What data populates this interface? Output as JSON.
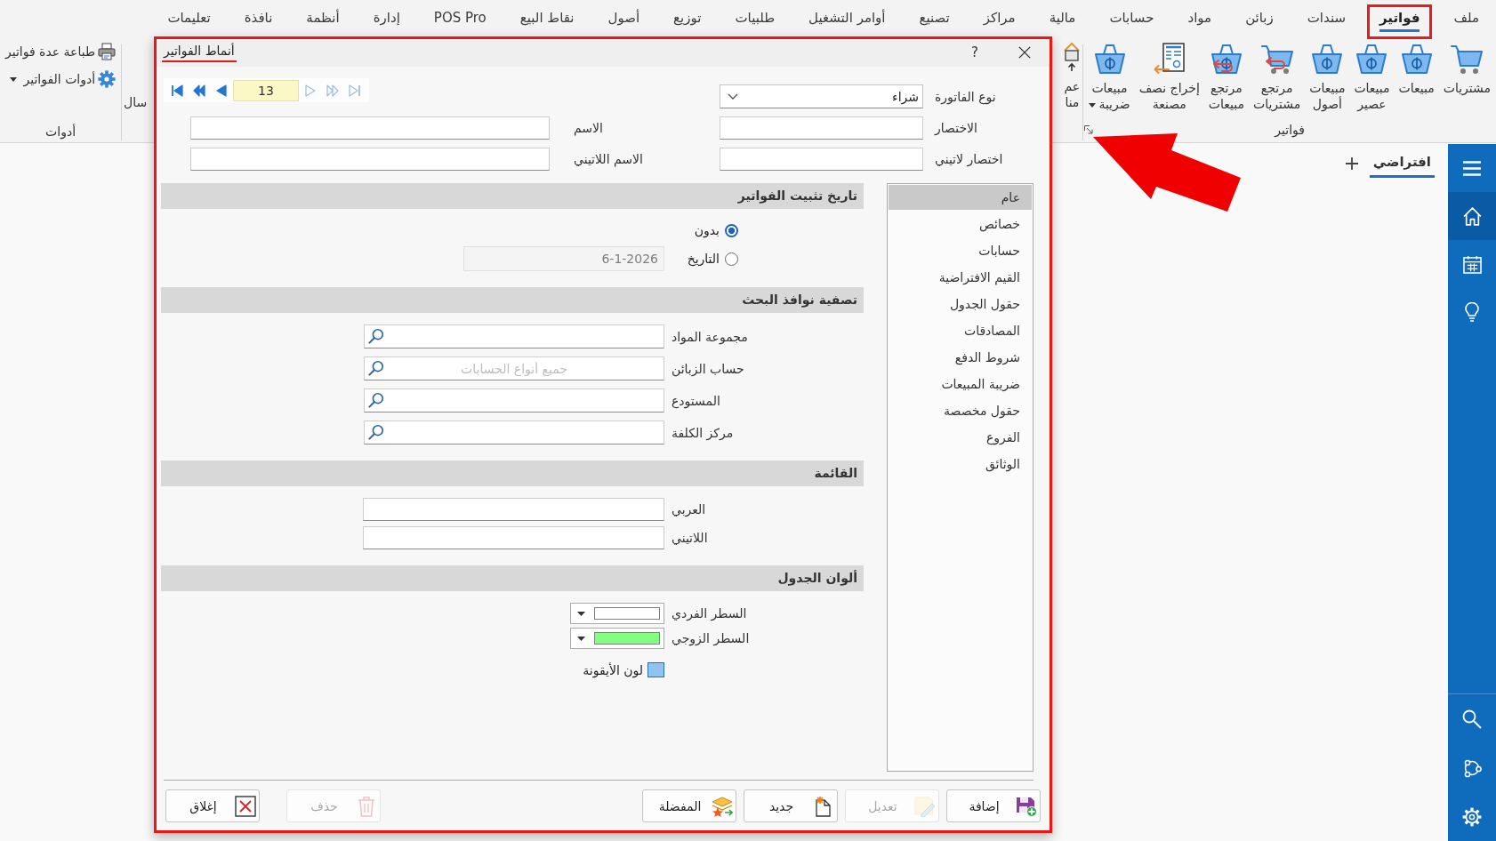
{
  "menu_bar": {
    "items": [
      {
        "label": "ملف",
        "selected": false,
        "highlighted": false
      },
      {
        "label": "فواتير",
        "selected": true,
        "highlighted": true
      },
      {
        "label": "سندات",
        "selected": false,
        "highlighted": false
      },
      {
        "label": "زبائن",
        "selected": false,
        "highlighted": false
      },
      {
        "label": "مواد",
        "selected": false,
        "highlighted": false
      },
      {
        "label": "حسابات",
        "selected": false,
        "highlighted": false
      },
      {
        "label": "مالية",
        "selected": false,
        "highlighted": false
      },
      {
        "label": "مراكز",
        "selected": false,
        "highlighted": false
      },
      {
        "label": "تصنيع",
        "selected": false,
        "highlighted": false
      },
      {
        "label": "أوامر التشغيل",
        "selected": false,
        "highlighted": false
      },
      {
        "label": "طلبيات",
        "selected": false,
        "highlighted": false
      },
      {
        "label": "توزيع",
        "selected": false,
        "highlighted": false
      },
      {
        "label": "أصول",
        "selected": false,
        "highlighted": false
      },
      {
        "label": "نقاط البيع",
        "selected": false,
        "highlighted": false
      },
      {
        "label": "POS Pro",
        "selected": false,
        "highlighted": false
      },
      {
        "label": "إدارة",
        "selected": false,
        "highlighted": false
      },
      {
        "label": "أنظمة",
        "selected": false,
        "highlighted": false
      },
      {
        "label": "نافذة",
        "selected": false,
        "highlighted": false
      },
      {
        "label": "تعليمات",
        "selected": false,
        "highlighted": false
      }
    ]
  },
  "ribbon": {
    "groups": [
      {
        "label": "فواتير",
        "kind": "large",
        "launcher": {
          "arrow": true
        },
        "buttons": [
          {
            "label": "مشتريات",
            "kind": "cart",
            "dropdown": false
          },
          {
            "label": "مبيعات",
            "kind": "basket",
            "dropdown": false
          },
          {
            "label": "مبيعات\nعصير",
            "kind": "basket",
            "dropdown": false
          },
          {
            "label": "مبيعات\nأصول",
            "kind": "basket",
            "dropdown": false
          },
          {
            "label": "مرتجع\nمشتريات",
            "kind": "cart-return",
            "dropdown": false
          },
          {
            "label": "مرتجع\nمبيعات",
            "kind": "basket-return",
            "dropdown": false
          },
          {
            "label": "إخراج نصف\nمصنعة",
            "kind": "document-export",
            "dropdown": false
          },
          {
            "label": "مبيعات\nضريبة",
            "kind": "basket",
            "dropdown": true
          }
        ]
      },
      {
        "kind": "partial",
        "buttons": [
          {
            "label": "عم\nمنا",
            "kind": "house",
            "dropdown": false
          },
          {
            "label": "سال",
            "kind": "none",
            "dropdown": false
          }
        ]
      },
      {
        "label": "أدوات",
        "kind": "small",
        "buttons": [
          {
            "label": "طباعة عدة فواتير",
            "kind": "printer",
            "dropdown": false
          },
          {
            "label": "أدوات الفواتير",
            "kind": "gear",
            "dropdown": true
          }
        ]
      }
    ]
  },
  "workspace": {
    "tabs": [
      {
        "label": "افتراضي",
        "selected": true
      }
    ]
  },
  "nav_bar": {
    "items": [
      {
        "kind": "menu",
        "selected": false
      },
      {
        "kind": "home",
        "selected": true
      },
      {
        "kind": "calendar",
        "selected": false
      },
      {
        "kind": "bulb",
        "selected": false
      }
    ],
    "bottom_items": [
      {
        "kind": "search",
        "selected": false
      },
      {
        "kind": "network",
        "selected": false
      },
      {
        "kind": "settings",
        "selected": false
      }
    ]
  },
  "dialog": {
    "title": "أنماط الفواتير",
    "highlighted": true,
    "help": "?",
    "navigator": {
      "back": [
        {
          "kind": "first",
          "disabled": false
        },
        {
          "kind": "rewind",
          "disabled": false
        },
        {
          "kind": "previous",
          "disabled": false
        }
      ],
      "record": "13",
      "forward": [
        {
          "kind": "next",
          "disabled": true
        },
        {
          "kind": "fast-forward",
          "disabled": true
        },
        {
          "kind": "last",
          "disabled": true
        }
      ]
    },
    "header_rows": [
      [
        {
          "label": "نوع الفاتورة",
          "kind": "dropdown",
          "value": "شراء"
        }
      ],
      [
        {
          "label": "الاختصار",
          "kind": "text"
        },
        {
          "label": "الاسم",
          "kind": "text"
        }
      ],
      [
        {
          "label": "اختصار لاتيني",
          "kind": "text"
        },
        {
          "label": "الاسم اللاتيني",
          "kind": "text"
        }
      ]
    ],
    "categories": [
      {
        "label": "عام",
        "selected": true
      },
      {
        "label": "خصائص",
        "selected": false
      },
      {
        "label": "حسابات",
        "selected": false
      },
      {
        "label": "القيم الافتراضية",
        "selected": false
      },
      {
        "label": "حقول الجدول",
        "selected": false
      },
      {
        "label": "المصادقات",
        "selected": false
      },
      {
        "label": "شروط الدفع",
        "selected": false
      },
      {
        "label": "ضريبة المبيعات",
        "selected": false
      },
      {
        "label": "حقول مخصصة",
        "selected": false
      },
      {
        "label": "الفروع",
        "selected": false
      },
      {
        "label": "الوثائق",
        "selected": false
      }
    ],
    "sections": [
      {
        "title": "تاريخ تثبيت الفواتير",
        "kind": "radios",
        "options": [
          {
            "label": "بدون",
            "selected": true
          },
          {
            "label": "التاريخ",
            "selected": false,
            "date": "6-1-2026"
          }
        ]
      },
      {
        "title": "تصفية نوافذ البحث",
        "kind": "lookups",
        "fields": [
          {
            "label": "مجموعة المواد"
          },
          {
            "label": "حساب الزبائن",
            "placeholder": "جميع أنواع الحسابات"
          },
          {
            "label": "المستودع"
          },
          {
            "label": "مركز الكلفة"
          }
        ]
      },
      {
        "title": "القائمة",
        "kind": "texts",
        "fields": [
          {
            "label": "العربي"
          },
          {
            "label": "اللاتيني"
          }
        ]
      },
      {
        "title": "ألوان الجدول",
        "kind": "colors",
        "fields": [
          {
            "label": "السطر الفردي",
            "kind": "dropdown",
            "color": "#ffffff"
          },
          {
            "label": "السطر الزوجي",
            "kind": "dropdown",
            "color": "#80ff80"
          },
          {
            "label": "لون الأيقونة",
            "kind": "swatch",
            "color": "#8ec4f0"
          }
        ]
      }
    ],
    "buttons": [
      {
        "label": "إضافة",
        "kind": "add",
        "disabled": false
      },
      {
        "label": "تعديل",
        "kind": "edit",
        "disabled": true
      },
      {
        "label": "جديد",
        "kind": "new",
        "disabled": false
      },
      {
        "label": "المفضلة",
        "kind": "favorites",
        "disabled": false
      }
    ],
    "end_buttons": [
      {
        "label": "حذف",
        "kind": "delete",
        "disabled": true
      },
      {
        "label": "إغلاق",
        "kind": "close",
        "disabled": false
      }
    ]
  }
}
